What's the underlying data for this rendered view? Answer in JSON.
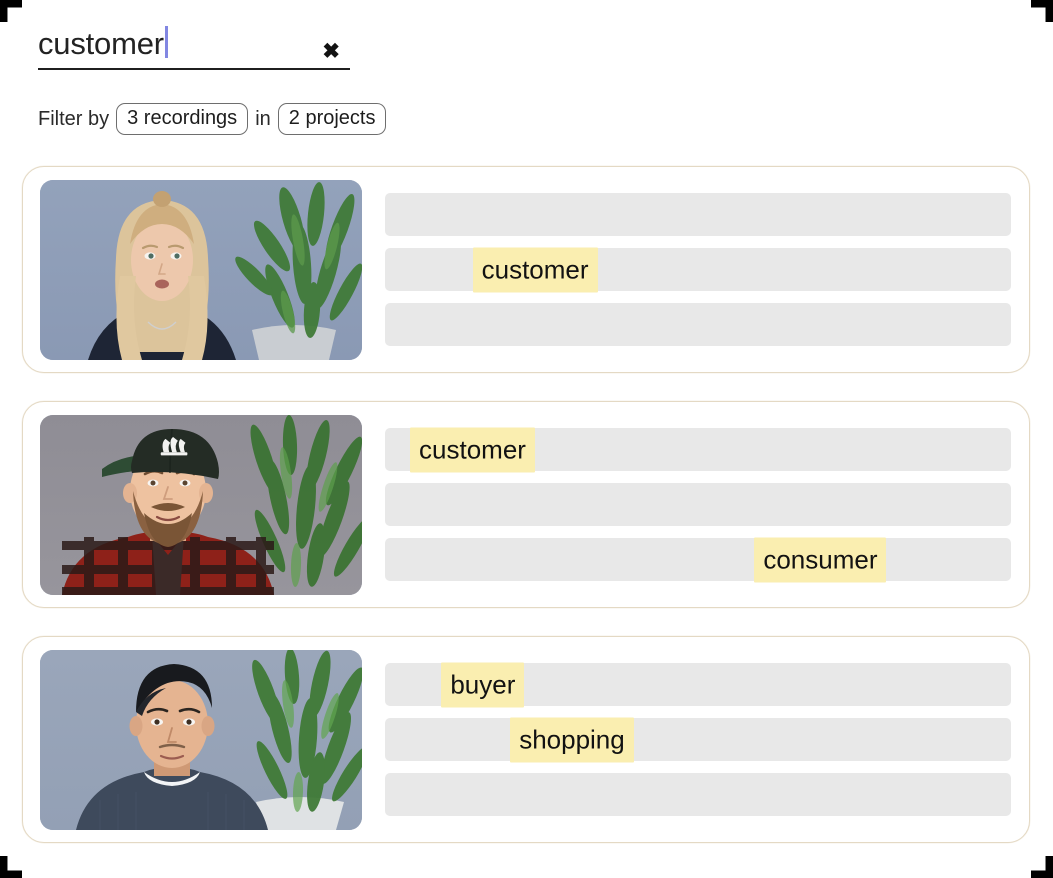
{
  "search": {
    "value": "customer",
    "placeholder": "Search",
    "clear_label": "✖",
    "clear_icon": "close-icon",
    "caret_color": "#8287e2"
  },
  "filter": {
    "prefix": "Filter by",
    "recordings_chip": "3 recordings",
    "joiner": "in",
    "projects_chip": "2 projects"
  },
  "colors": {
    "card_border": "#e4d9c4",
    "skeleton": "#e8e8e8",
    "highlight": "#faeeb0",
    "text": "#121212"
  },
  "results": [
    {
      "thumbnail_name": "recording-thumbnail-blonde-woman",
      "thumbnail_alt": "Blonde woman in dark navy top seated in front of blue-grey wall with tall green plant",
      "lines": [
        {
          "highlight": null,
          "offset_pct": 0
        },
        {
          "highlight": "customer",
          "offset_pct": 14
        },
        {
          "highlight": null,
          "offset_pct": 0
        }
      ]
    },
    {
      "thumbnail_name": "recording-thumbnail-bearded-man-cap",
      "thumbnail_alt": "Bearded man in dark green cap and red plaid shirt in front of grey wall with green plant",
      "lines": [
        {
          "highlight": "customer",
          "offset_pct": 4
        },
        {
          "highlight": null,
          "offset_pct": 0
        },
        {
          "highlight": "consumer",
          "offset_pct": 59
        }
      ]
    },
    {
      "thumbnail_name": "recording-thumbnail-dark-haired-man",
      "thumbnail_alt": "Dark haired man in navy sweater in front of blue-grey wall with green plant in white pot",
      "lines": [
        {
          "highlight": "buyer",
          "offset_pct": 9
        },
        {
          "highlight": "shopping",
          "offset_pct": 20
        },
        {
          "highlight": null,
          "offset_pct": 0
        }
      ]
    }
  ]
}
